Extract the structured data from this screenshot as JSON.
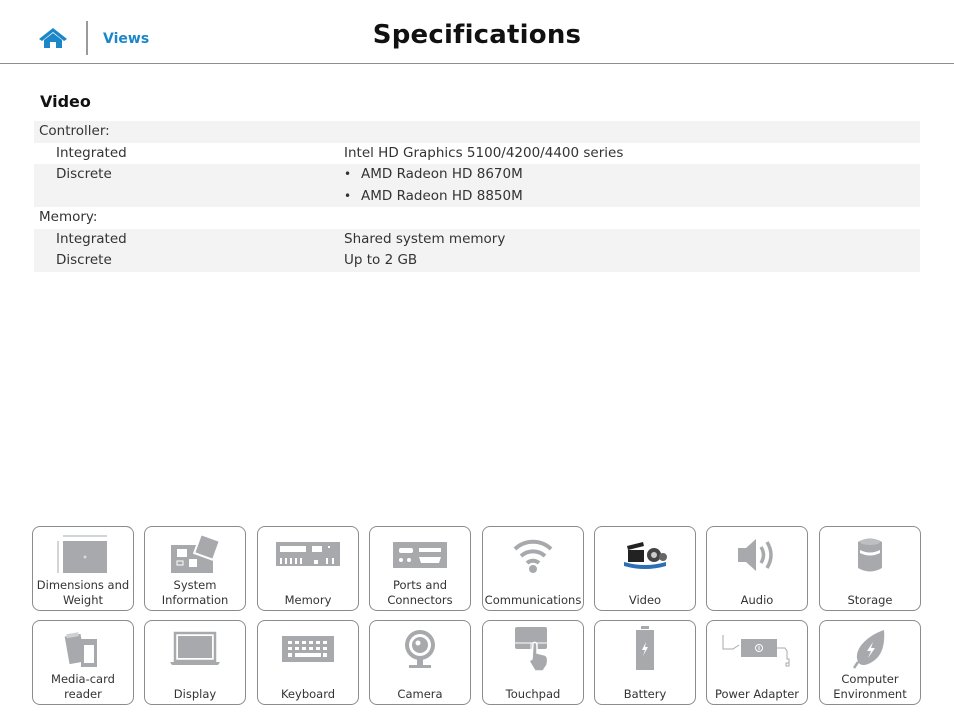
{
  "header": {
    "home_icon": "home-icon",
    "views_label": "Views",
    "title": "Specifications"
  },
  "colors": {
    "accent": "#1b87c9",
    "row_shade": "#f3f3f3",
    "icon_gray": "#a7a9ac",
    "tile_border": "#8c8c8c"
  },
  "section": {
    "title": "Video",
    "rows": [
      {
        "label": "Controller:",
        "value": ""
      },
      {
        "label": "Integrated",
        "value": "Intel HD Graphics 5100/4200/4400 series"
      },
      {
        "label": "Discrete",
        "bullets": [
          "AMD Radeon HD 8670M",
          "AMD Radeon HD 8850M"
        ]
      },
      {
        "label": "Memory:",
        "value": ""
      },
      {
        "label": "Integrated",
        "value": "Shared system memory"
      },
      {
        "label": "Discrete",
        "value": "Up to 2 GB"
      }
    ]
  },
  "tiles": [
    {
      "label": "Dimensions and Weight",
      "icon": "dimensions-icon"
    },
    {
      "label": "System Information",
      "icon": "motherboard-icon"
    },
    {
      "label": "Memory",
      "icon": "memory-module-icon"
    },
    {
      "label": "Ports and Connectors",
      "icon": "ports-icon"
    },
    {
      "label": "Communications",
      "icon": "wifi-icon"
    },
    {
      "label": "Video",
      "icon": "film-clapper-icon"
    },
    {
      "label": "Audio",
      "icon": "speaker-icon"
    },
    {
      "label": "Storage",
      "icon": "database-icon"
    },
    {
      "label": "Media-card reader",
      "icon": "sd-card-icon"
    },
    {
      "label": "Display",
      "icon": "laptop-icon"
    },
    {
      "label": "Keyboard",
      "icon": "keyboard-icon"
    },
    {
      "label": "Camera",
      "icon": "webcam-icon"
    },
    {
      "label": "Touchpad",
      "icon": "touchpad-icon"
    },
    {
      "label": "Battery",
      "icon": "battery-icon"
    },
    {
      "label": "Power Adapter",
      "icon": "power-adapter-icon"
    },
    {
      "label": "Computer Environment",
      "icon": "leaf-icon"
    }
  ]
}
